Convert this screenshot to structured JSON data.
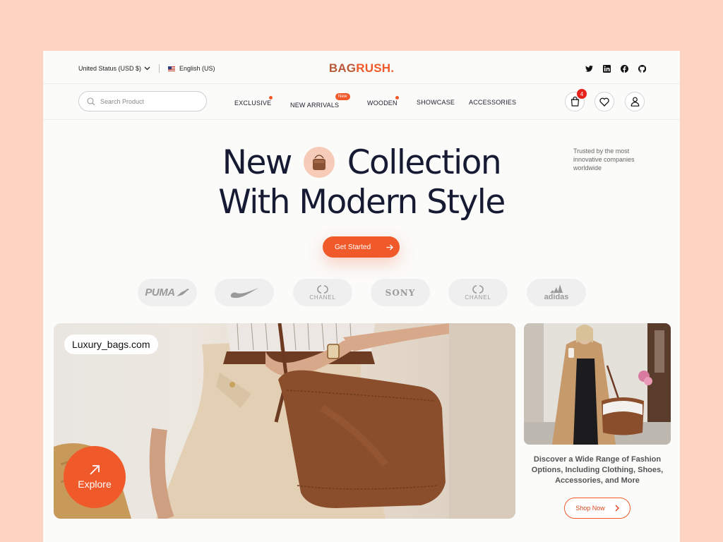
{
  "topbar": {
    "region": "United Status (USD $)",
    "language": "English (US)",
    "logo_part1": "BAG",
    "logo_part2": "RUSH."
  },
  "nav": {
    "search_placeholder": "Search Product",
    "items": [
      {
        "label": "EXCLUSIVE"
      },
      {
        "label": "NEW ARRIVALS",
        "badge": "New"
      },
      {
        "label": "WOODEN"
      },
      {
        "label": "SHOWCASE"
      },
      {
        "label": "ACCESSORIES"
      }
    ],
    "cart_count": "4"
  },
  "hero": {
    "title_word1": "New",
    "title_word2": "Collection",
    "title_line2": "With Modern Style",
    "trusted_text": "Trusted by the most innovative companies worldwide",
    "cta_label": "Get Started"
  },
  "brands": [
    {
      "name": "PUMA"
    },
    {
      "name": "Nike"
    },
    {
      "name": "CHANEL"
    },
    {
      "name": "SONY"
    },
    {
      "name": "CHANEL"
    },
    {
      "name": "adidas"
    }
  ],
  "feature": {
    "url_label": "Luxury_bags.com",
    "explore_label": "Explore"
  },
  "side": {
    "description": "Discover a Wide Range of Fashion Options, Including Clothing, Shoes, Accessories, and More",
    "shop_label": "Shop Now"
  },
  "colors": {
    "accent": "#f05a2a",
    "background": "#fcd3c0",
    "heading": "#161a33"
  }
}
